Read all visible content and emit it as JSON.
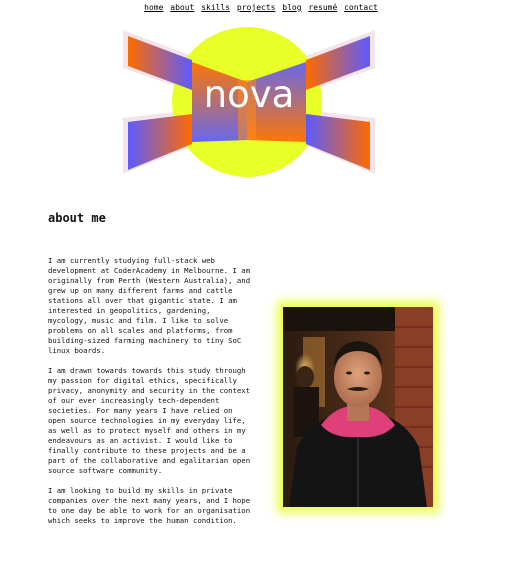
{
  "nav": {
    "items": [
      {
        "label": "home"
      },
      {
        "label": "about"
      },
      {
        "label": "skills"
      },
      {
        "label": "projects"
      },
      {
        "label": "blog"
      },
      {
        "label": "resumé"
      },
      {
        "label": "contact"
      }
    ]
  },
  "logo": {
    "text": "nova"
  },
  "about": {
    "title": "about me",
    "paragraphs": [
      "I am currently studying full-stack web development at CoderAcademy in Melbourne. I am originally from Perth (Western Australia), and grew up on many different farms and cattle stations all over that gigantic state. I am interested in geopolitics, gardening, mycology, music and film. I like to solve problems on all scales and platforms, from building-sized farming machinery to tiny SoC linux boards.",
      "I am drawn towards towards this study through my passion for digital ethics, specifically privacy, anonymity and security in the context of our ever increasingly tech-dependent societies. For many years I have relied on open source technologies in my everyday life, as well as to protect myself and others in my endeavours as an activist. I would like to finally contribute to these projects and be a part of the collaborative and egalitarian open source software community.",
      "I am looking to build my skills in private companies over the next many years, and I hope to one day be able to work for an organisation which seeks to improve the human condition."
    ]
  },
  "colors": {
    "yellow": "#e9ff28",
    "orange": "#ff6a00",
    "blue": "#5b5bff",
    "pink": "#f2e4ea"
  }
}
